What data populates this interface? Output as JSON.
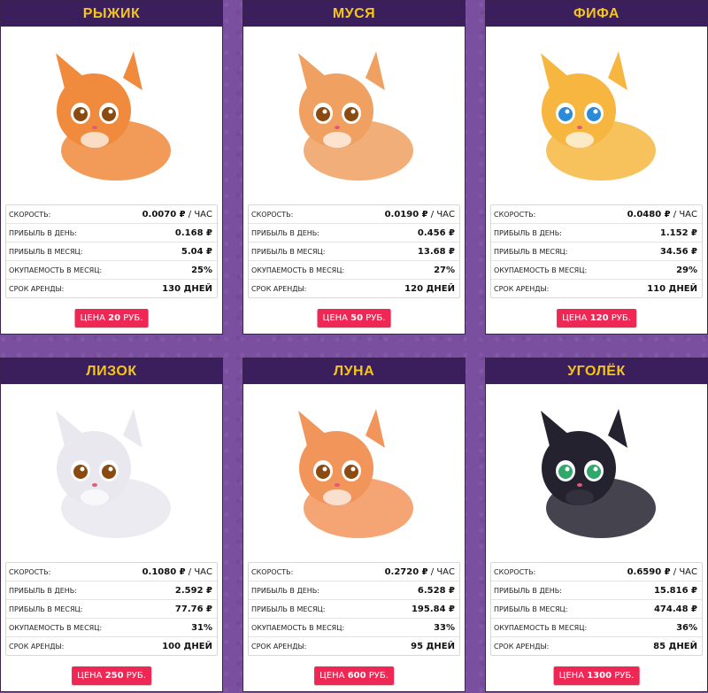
{
  "labels": {
    "speed": "СКОРОСТЬ:",
    "per_day": "ПРИБЫЛЬ В ДЕНЬ:",
    "per_month": "ПРИБЫЛЬ В МЕСЯЦ:",
    "payback": "ОКУПАЕМОСТЬ В МЕСЯЦ:",
    "term": "СРОК АРЕНДЫ:",
    "price_prefix": "ЦЕНА ",
    "price_suffix": " РУБ.",
    "speed_unit": " / ЧАС"
  },
  "cards": [
    {
      "name": "РЫЖИК",
      "speed": "0.0070 ₽",
      "per_day": "0.168 ₽",
      "per_month": "5.04 ₽",
      "payback": "25%",
      "term": "130 ДНЕЙ",
      "price": "20",
      "color": "#f08a3c"
    },
    {
      "name": "МУСЯ",
      "speed": "0.0190 ₽",
      "per_day": "0.456 ₽",
      "per_month": "13.68 ₽",
      "payback": "27%",
      "term": "120 ДНЕЙ",
      "price": "50",
      "color": "#f0a060"
    },
    {
      "name": "ФИФА",
      "speed": "0.0480 ₽",
      "per_day": "1.152 ₽",
      "per_month": "34.56 ₽",
      "payback": "29%",
      "term": "110 ДНЕЙ",
      "price": "120",
      "color": "#f6b640"
    },
    {
      "name": "ЛИЗОК",
      "speed": "0.1080 ₽",
      "per_day": "2.592 ₽",
      "per_month": "77.76 ₽",
      "payback": "31%",
      "term": "100 ДНЕЙ",
      "price": "250",
      "color": "#e8e8ee"
    },
    {
      "name": "ЛУНА",
      "speed": "0.2720 ₽",
      "per_day": "6.528 ₽",
      "per_month": "195.84 ₽",
      "payback": "33%",
      "term": "95 ДНЕЙ",
      "price": "600",
      "color": "#f2955a"
    },
    {
      "name": "УГОЛЁК",
      "speed": "0.6590 ₽",
      "per_day": "15.816 ₽",
      "per_month": "474.48 ₽",
      "payback": "36%",
      "term": "85 ДНЕЙ",
      "price": "1300",
      "color": "#24222e"
    }
  ]
}
